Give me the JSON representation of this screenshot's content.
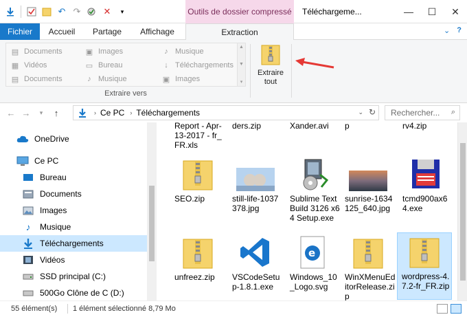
{
  "window": {
    "contextual_tab": "Outils de dossier compressé",
    "title": "Téléchargeme..."
  },
  "ribbon_tabs": {
    "file": "Fichier",
    "home": "Accueil",
    "share": "Partage",
    "view": "Affichage",
    "extract": "Extraction"
  },
  "ribbon": {
    "destinations": [
      "Documents",
      "Images",
      "Musique",
      "Vidéos",
      "Bureau",
      "Téléchargements",
      "Documents",
      "Musique",
      "Images"
    ],
    "group_label": "Extraire vers",
    "extract_all_label": "Extraire tout"
  },
  "address": {
    "crumbs": [
      "Ce PC",
      "Téléchargements"
    ],
    "search_placeholder": "Rechercher..."
  },
  "nav_pane": {
    "items": [
      {
        "label": "OneDrive",
        "icon": "cloud-icon"
      },
      {
        "label": "Ce PC",
        "icon": "computer-icon"
      },
      {
        "label": "Bureau",
        "icon": "desktop-icon"
      },
      {
        "label": "Documents",
        "icon": "documents-icon"
      },
      {
        "label": "Images",
        "icon": "pictures-icon"
      },
      {
        "label": "Musique",
        "icon": "music-icon"
      },
      {
        "label": "Téléchargements",
        "icon": "downloads-icon"
      },
      {
        "label": "Vidéos",
        "icon": "videos-icon"
      },
      {
        "label": "SSD principal (C:)",
        "icon": "drive-icon"
      },
      {
        "label": "500Go Clône de C (D:)",
        "icon": "drive-icon"
      }
    ]
  },
  "files": {
    "top_row": [
      "Report - Apr-13-2017 - fr_FR.xls",
      "ders.zip",
      "Xander.avi",
      "p",
      "rv4.zip"
    ],
    "row2": [
      {
        "label": "SEO.zip",
        "type": "zip"
      },
      {
        "label": "still-life-1037378.jpg",
        "type": "image-teddy"
      },
      {
        "label": "Sublime Text Build 3126 x64 Setup.exe",
        "type": "installer"
      },
      {
        "label": "sunrise-1634125_640.jpg",
        "type": "image-sunrise"
      },
      {
        "label": "tcmd900ax64.exe",
        "type": "floppy"
      }
    ],
    "row3": [
      {
        "label": "unfreez.zip",
        "type": "zip"
      },
      {
        "label": "VSCodeSetup-1.8.1.exe",
        "type": "vscode"
      },
      {
        "label": "Windows_10_Logo.svg",
        "type": "edge"
      },
      {
        "label": "WinXMenuEditorRelease.zip",
        "type": "zip"
      },
      {
        "label": "wordpress-4.7.2-fr_FR.zip",
        "type": "zip"
      }
    ]
  },
  "status": {
    "count": "55 élément(s)",
    "selection": "1 élément sélectionné  8,79 Mo"
  },
  "colors": {
    "accent": "#1979ca",
    "context_tab": "#f6d8ea",
    "selection": "#cce8ff",
    "arrow": "#e53935"
  }
}
